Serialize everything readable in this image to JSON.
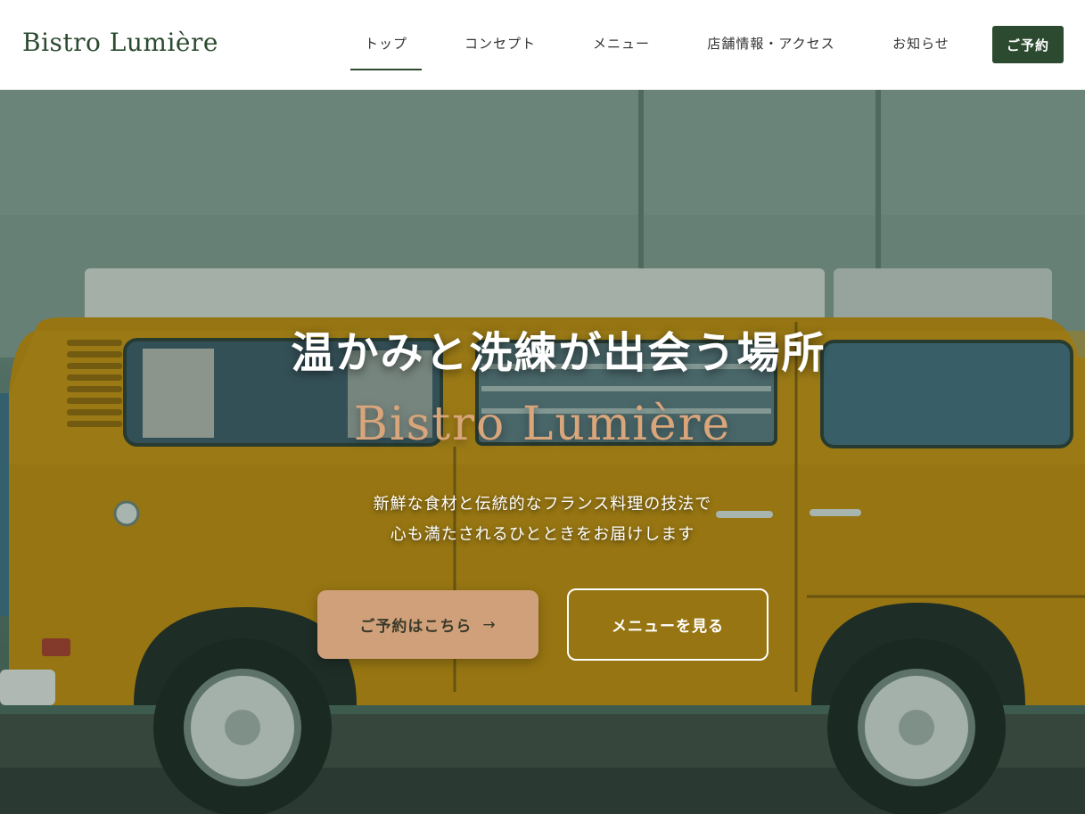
{
  "header": {
    "logo": "Bistro Lumière",
    "nav": [
      {
        "label": "トップ"
      },
      {
        "label": "コンセプト"
      },
      {
        "label": "メニュー"
      },
      {
        "label": "店舗情報・アクセス"
      },
      {
        "label": "お知らせ"
      }
    ],
    "reserve_label": "ご予約"
  },
  "hero": {
    "title": "温かみと洗練が出会う場所",
    "subtitle": "Bistro Lumière",
    "description_line1": "新鮮な食材と伝統的なフランス料理の技法で",
    "description_line2": "心も満たされるひとときをお届けします",
    "primary_button": {
      "label": "ご予約はこちら",
      "arrow": "→"
    },
    "secondary_button": {
      "label": "メニューを見る"
    }
  },
  "colors": {
    "brand_green": "#2c4a30",
    "accent_tan": "#d0a07a",
    "subtitle_color": "#d9a57a"
  }
}
